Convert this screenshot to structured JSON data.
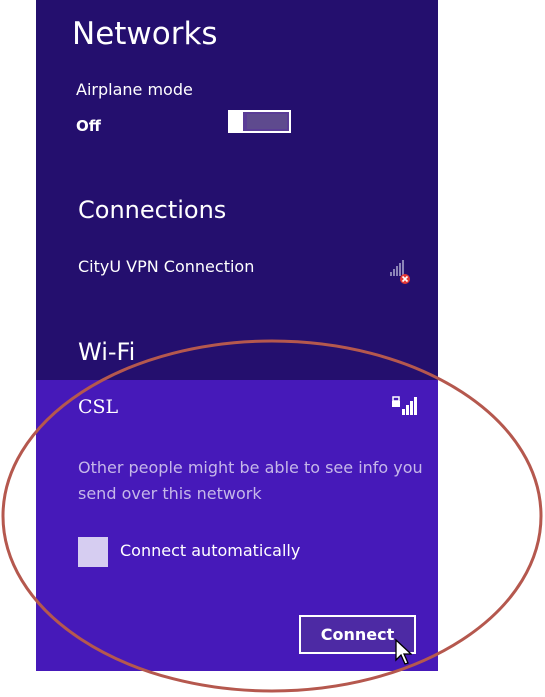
{
  "app": {
    "title": "Networks"
  },
  "airplane_mode": {
    "label": "Airplane mode",
    "state": "Off",
    "on": false
  },
  "connections": {
    "heading": "Connections",
    "items": [
      {
        "name": "CityU VPN Connection",
        "icon": "vpn-disconnected-icon"
      }
    ]
  },
  "wifi": {
    "heading": "Wi-Fi",
    "networks": [
      {
        "name": "CSL",
        "icon": "wifi-secured-signal-icon",
        "warning": "Other people might be able to see info you send over this network",
        "connect_automatically_label": "Connect automatically",
        "connect_automatically": false,
        "connect_label": "Connect"
      }
    ]
  },
  "colors": {
    "panel_background": "#240f6e",
    "selected_background": "#4619b9",
    "annotation_circle": "#b5584e"
  }
}
